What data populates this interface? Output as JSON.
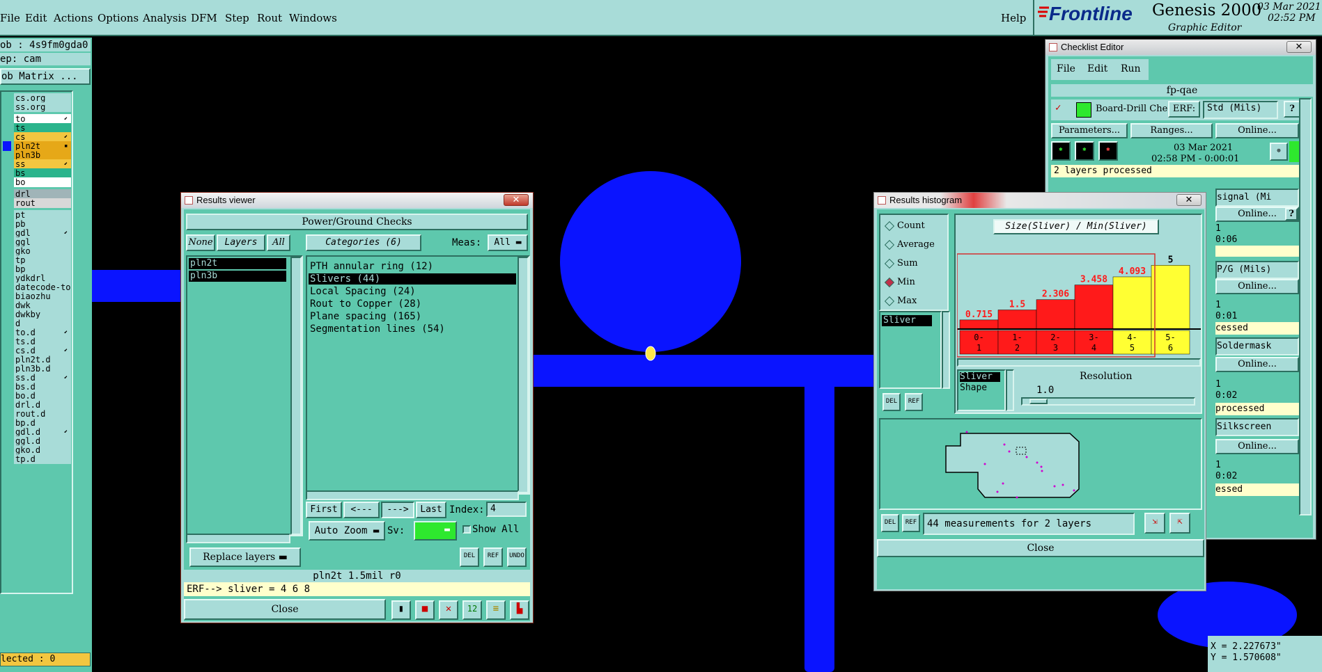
{
  "menubar": {
    "items": [
      "File",
      "Edit",
      "Actions",
      "Options",
      "Analysis",
      "DFM",
      "Step",
      "Rout",
      "Windows"
    ],
    "help": "Help",
    "logo": "Frontline",
    "app_title": "Genesis 2000",
    "app_subtitle": "Graphic Editor",
    "date": "03 Mar 2021",
    "time": "02:52 PM"
  },
  "left_panel": {
    "job": "ob : 4s9fm0gda0",
    "step": "ep: cam",
    "matrix_button": "ob Matrix ...",
    "layers": [
      {
        "name": "cs.org",
        "color": "#a8dcd8",
        "mark": ""
      },
      {
        "name": "ss.org",
        "color": "#a8dcd8",
        "mark": ""
      },
      {
        "name": "to",
        "color": "#ffffff",
        "mark": "⬋"
      },
      {
        "name": "ts",
        "color": "#2bb48c",
        "mark": ""
      },
      {
        "name": "cs",
        "color": "#f3c640",
        "mark": "⬋"
      },
      {
        "name": "pln2t",
        "color": "#e6a818",
        "mark": "▪"
      },
      {
        "name": "pln3b",
        "color": "#e6a818",
        "mark": ""
      },
      {
        "name": "ss",
        "color": "#f3c640",
        "mark": "⬋"
      },
      {
        "name": "bs",
        "color": "#2bb48c",
        "mark": ""
      },
      {
        "name": "bo",
        "color": "#ffffff",
        "mark": ""
      },
      {
        "name": "drl",
        "color": "#a0b4b8",
        "mark": ""
      },
      {
        "name": "rout",
        "color": "#d8d8d8",
        "mark": ""
      },
      {
        "name": "pt",
        "color": "#a8dcd8",
        "mark": ""
      },
      {
        "name": "pb",
        "color": "#a8dcd8",
        "mark": ""
      },
      {
        "name": "gdl",
        "color": "#a8dcd8",
        "mark": "⬋"
      },
      {
        "name": "ggl",
        "color": "#a8dcd8",
        "mark": ""
      },
      {
        "name": "gko",
        "color": "#a8dcd8",
        "mark": ""
      },
      {
        "name": "tp",
        "color": "#a8dcd8",
        "mark": ""
      },
      {
        "name": "bp",
        "color": "#a8dcd8",
        "mark": ""
      },
      {
        "name": "ydkdrl",
        "color": "#a8dcd8",
        "mark": ""
      },
      {
        "name": "datecode-to",
        "color": "#a8dcd8",
        "mark": ""
      },
      {
        "name": "biaozhu",
        "color": "#a8dcd8",
        "mark": ""
      },
      {
        "name": "dwk",
        "color": "#a8dcd8",
        "mark": ""
      },
      {
        "name": "dwkby",
        "color": "#a8dcd8",
        "mark": ""
      },
      {
        "name": "d",
        "color": "#a8dcd8",
        "mark": ""
      },
      {
        "name": "to.d",
        "color": "#a8dcd8",
        "mark": "⬋"
      },
      {
        "name": "ts.d",
        "color": "#a8dcd8",
        "mark": ""
      },
      {
        "name": "cs.d",
        "color": "#a8dcd8",
        "mark": "⬋"
      },
      {
        "name": "pln2t.d",
        "color": "#a8dcd8",
        "mark": ""
      },
      {
        "name": "pln3b.d",
        "color": "#a8dcd8",
        "mark": ""
      },
      {
        "name": "ss.d",
        "color": "#a8dcd8",
        "mark": "⬋"
      },
      {
        "name": "bs.d",
        "color": "#a8dcd8",
        "mark": ""
      },
      {
        "name": "bo.d",
        "color": "#a8dcd8",
        "mark": ""
      },
      {
        "name": "drl.d",
        "color": "#a8dcd8",
        "mark": ""
      },
      {
        "name": "rout.d",
        "color": "#a8dcd8",
        "mark": ""
      },
      {
        "name": "bp.d",
        "color": "#a8dcd8",
        "mark": ""
      },
      {
        "name": "gdl.d",
        "color": "#a8dcd8",
        "mark": "⬋"
      },
      {
        "name": "ggl.d",
        "color": "#a8dcd8",
        "mark": ""
      },
      {
        "name": "gko.d",
        "color": "#a8dcd8",
        "mark": ""
      },
      {
        "name": "tp.d",
        "color": "#a8dcd8",
        "mark": ""
      }
    ],
    "selected": "lected : 0"
  },
  "results_viewer": {
    "title": "Results viewer",
    "header": "Power/Ground Checks",
    "btn_none": "None",
    "btn_layers": "Layers",
    "btn_all": "All",
    "categories_label": "Categories (6)",
    "meas_label": "Meas:",
    "meas_value": "All",
    "layers": [
      "pln2t",
      "pln3b"
    ],
    "categories": [
      "PTH annular ring (12)",
      "Slivers (44)",
      "Local Spacing (24)",
      "Rout to Copper (28)",
      "Plane spacing (165)",
      "Segmentation lines (54)"
    ],
    "selected_category_index": 1,
    "nav": {
      "first": "First",
      "prev": "<---",
      "next": "--->",
      "last": "Last",
      "index_label": "Index:",
      "index_value": "4"
    },
    "auto_zoom": "Auto Zoom",
    "sv_label": "Sv:",
    "show_all": "Show All",
    "replace_layers": "Replace layers",
    "icons": [
      "DEL",
      "REF",
      "UNDO"
    ],
    "status": "pln2t 1.5mil  r0",
    "erf": "ERF--> sliver = 4 6 8",
    "close": "Close"
  },
  "histogram": {
    "title": "Results histogram",
    "options": [
      "Count",
      "Average",
      "Sum",
      "Min",
      "Max"
    ],
    "selected_option": "Min",
    "list_item": "Sliver",
    "chart_title": "Size(Sliver) / Min(Sliver)",
    "shape_items": [
      "Sliver",
      "Shape"
    ],
    "resolution_label": "Resolution",
    "resolution_value": "1.0",
    "measurements": "44 measurements for 2 layers",
    "close": "Close"
  },
  "chart_data": {
    "type": "bar",
    "title": "Size(Sliver) / Min(Sliver)",
    "categories": [
      "0-1",
      "1-2",
      "2-3",
      "3-4",
      "4-5",
      "5-6"
    ],
    "values": [
      0.715,
      1.5,
      2.306,
      3.458,
      4.093,
      5
    ],
    "value_labels": [
      "0.715",
      "1.5",
      "2.306",
      "3.458",
      "4.093",
      "5"
    ],
    "bar_colors": [
      "#ff1a1a",
      "#ff1a1a",
      "#ff1a1a",
      "#ff1a1a",
      "#ffff33",
      "#ffff33"
    ],
    "label_colors": [
      "#ff1a1a",
      "#ff1a1a",
      "#ff1a1a",
      "#ff1a1a",
      "#ff1a1a",
      "#000000"
    ],
    "ylim": [
      0,
      6
    ]
  },
  "checklist": {
    "title": "Checklist Editor",
    "menu": [
      "File",
      "Edit",
      "Run"
    ],
    "name": "fp-qae",
    "row1": {
      "label": "Board-Drill Che",
      "erf": "ERF:",
      "field": "Std (Mils)"
    },
    "buttons": [
      "Parameters...",
      "Ranges...",
      "Online..."
    ],
    "date": "03 Mar 2021",
    "time": "02:58 PM - 0:00:01",
    "processed": "2 layers processed",
    "fields": [
      "signal (Mi",
      "P/G (Mils)",
      "Soldermask",
      "Silkscreen"
    ],
    "online": "Online...",
    "times": [
      "0:06",
      "0:01",
      "0:02",
      "0:02"
    ],
    "processed_short": [
      "cessed",
      "processed",
      "essed"
    ],
    "num": "1"
  },
  "coords": {
    "x": "X = 2.227673\"",
    "y": "Y = 1.570608\""
  }
}
